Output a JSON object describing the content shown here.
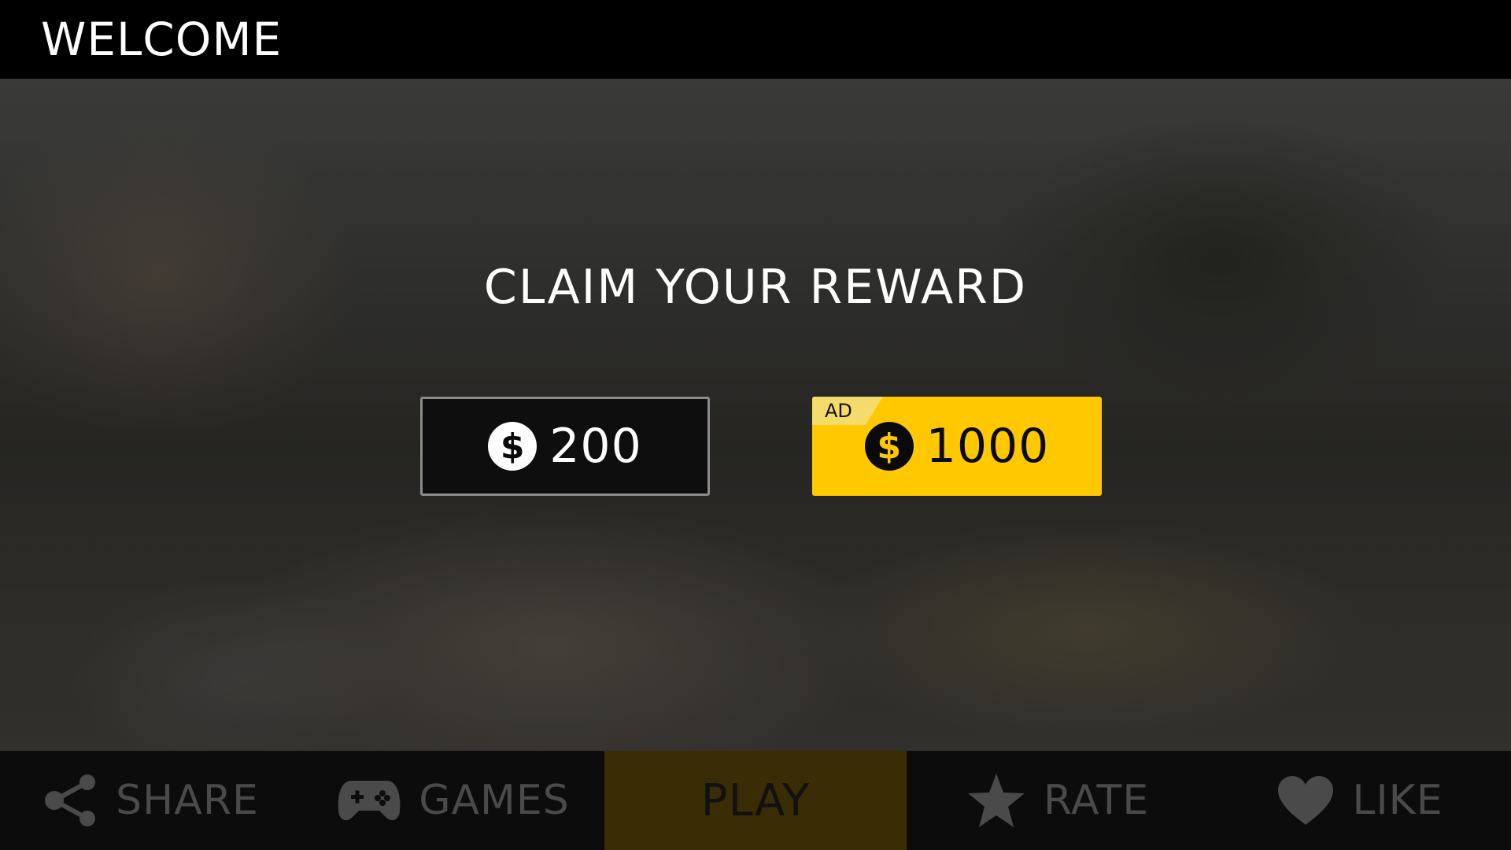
{
  "header": {
    "title": "WELCOME"
  },
  "main": {
    "title": "CLAIM YOUR REWARD",
    "rewards": [
      {
        "id": "free",
        "currency_symbol": "$",
        "amount": "200"
      },
      {
        "id": "ad",
        "tag": "AD",
        "currency_symbol": "$",
        "amount": "1000"
      }
    ]
  },
  "nav": {
    "items": [
      {
        "label": "SHARE",
        "icon": "share-icon"
      },
      {
        "label": "GAMES",
        "icon": "gamepad-icon"
      },
      {
        "label": "PLAY",
        "icon": ""
      },
      {
        "label": "RATE",
        "icon": "star-icon"
      },
      {
        "label": "LIKE",
        "icon": "heart-icon"
      }
    ]
  },
  "colors": {
    "accent": "#ffc800",
    "play_bg": "#3a2c05",
    "nav_text": "#4a4a4a",
    "header_bg": "#000000"
  }
}
